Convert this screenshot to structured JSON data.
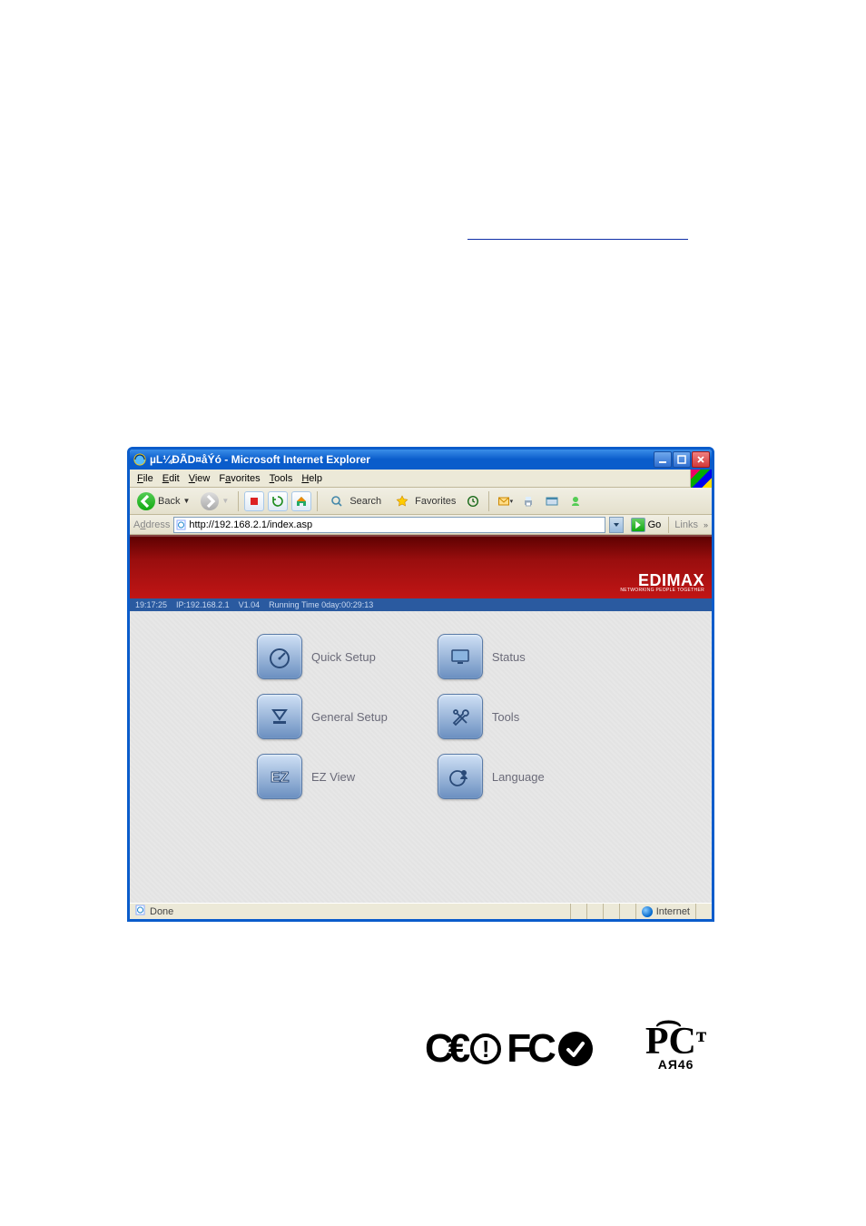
{
  "window": {
    "title": "µL¼ÐÃD¤åÝó - Microsoft Internet Explorer"
  },
  "menu": {
    "items": [
      "File",
      "Edit",
      "View",
      "Favorites",
      "Tools",
      "Help"
    ]
  },
  "toolbar": {
    "back": "Back",
    "search": "Search",
    "favorites": "Favorites"
  },
  "addressbar": {
    "label": "Address",
    "url": "http://192.168.2.1/index.asp",
    "go": "Go",
    "links": "Links"
  },
  "brand": {
    "name": "EDIMAX",
    "tagline": "NETWORKING PEOPLE TOGETHER"
  },
  "appstatus": {
    "time": "19:17:25",
    "ip_label": "IP:192.168.2.1",
    "version": "V1.04",
    "running": "Running Time 0day:00:29:13"
  },
  "tiles": {
    "quick_setup": "Quick Setup",
    "status": "Status",
    "general_setup": "General Setup",
    "tools": "Tools",
    "ez_view": "EZ View",
    "language": "Language"
  },
  "iestatus": {
    "done": "Done",
    "zone": "Internet"
  },
  "certs": {
    "pct_sub": "АЯ46"
  }
}
